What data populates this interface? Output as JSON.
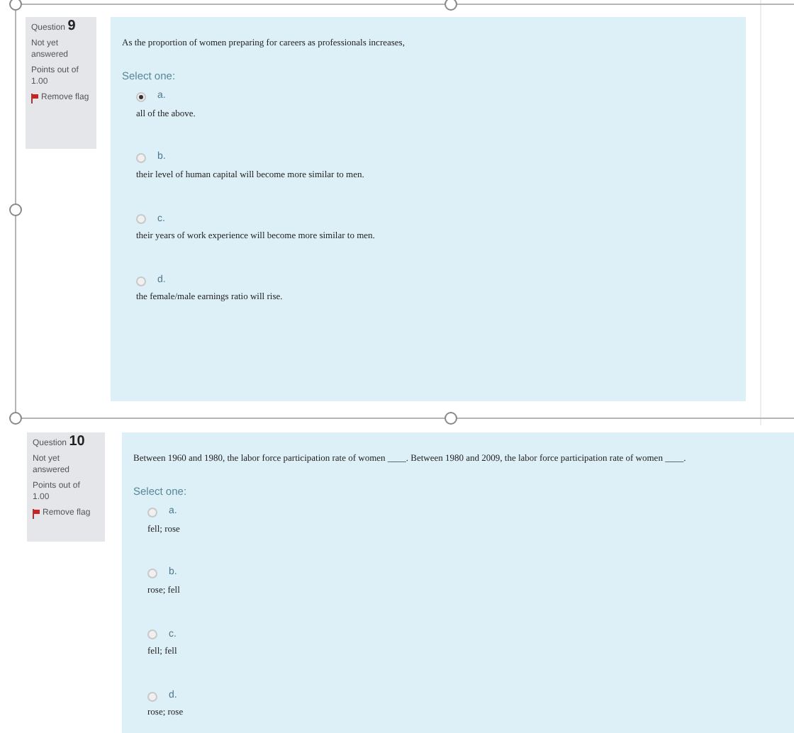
{
  "questions": [
    {
      "label": "Question",
      "number": "9",
      "status": "Not yet answered",
      "points": "Points out of 1.00",
      "flag": "Remove flag",
      "text": "As the proportion of women preparing for careers as professionals increases,",
      "prompt": "Select one:",
      "options": [
        {
          "letter": "a.",
          "text": "all of the above.",
          "selected": true
        },
        {
          "letter": "b.",
          "text": "their level of human capital will become more similar to men.",
          "selected": false
        },
        {
          "letter": "c.",
          "text": "their years of work experience will become more similar to men.",
          "selected": false
        },
        {
          "letter": "d.",
          "text": "the female/male earnings ratio will rise.",
          "selected": false
        }
      ]
    },
    {
      "label": "Question",
      "number": "10",
      "status": "Not yet answered",
      "points": "Points out of 1.00",
      "flag": "Remove flag",
      "text": "Between 1960 and 1980, the labor force participation rate of women ____. Between 1980 and 2009, the labor force participation rate of women ____.",
      "prompt": "Select one:",
      "options": [
        {
          "letter": "a.",
          "text": "fell; rose",
          "selected": false
        },
        {
          "letter": "b.",
          "text": "rose; fell",
          "selected": false
        },
        {
          "letter": "c.",
          "text": "fell; fell",
          "selected": false
        },
        {
          "letter": "d.",
          "text": "rose; rose",
          "selected": false
        }
      ]
    }
  ]
}
